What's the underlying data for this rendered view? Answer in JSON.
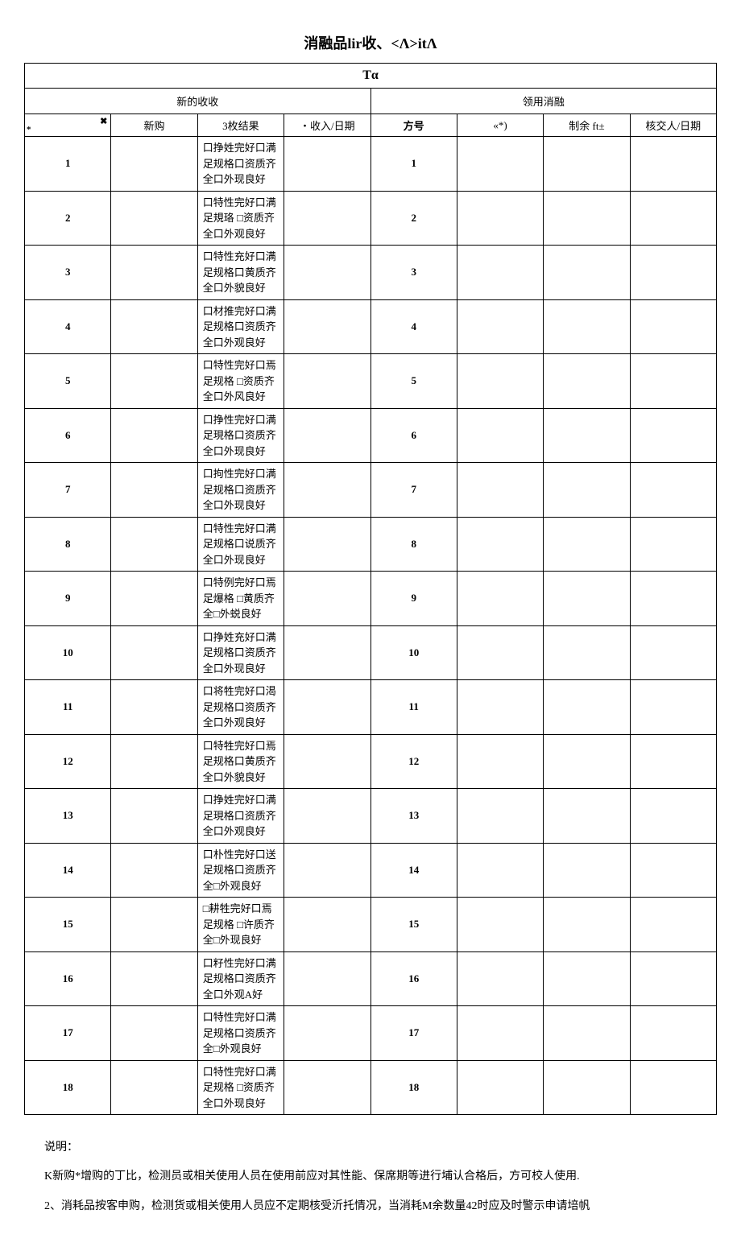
{
  "page_title": "消融品lir收、<Λ>itΛ",
  "table": {
    "top_header": "Tα",
    "left_section": "新的收收",
    "right_section": "领用消融",
    "headers": {
      "idx_symbol_top": "✖",
      "idx_symbol_bottom": "*",
      "xingou": "新购",
      "result": "3枚结果",
      "date_in": "・收入/日期",
      "fanghao": "方号",
      "star_col": "«*)",
      "zhiyu": "制余 ft±",
      "hejiao": "核交人/日期"
    },
    "rows": [
      {
        "idx": "1",
        "result": "口挣姓完好口满足规格口资质齐全口外现良好",
        "fh": "1"
      },
      {
        "idx": "2",
        "result": "口特性完好口满足規珞 □资质齐全口外观良好",
        "fh": "2"
      },
      {
        "idx": "3",
        "result": "口特性充好口满足规格口黄质齐全口外貌良好",
        "fh": "3"
      },
      {
        "idx": "4",
        "result": "口材推完好口满足规格口资质齐全口外观良好",
        "fh": "4"
      },
      {
        "idx": "5",
        "result": "口特性完好口焉足规格 □资质齐全口外风良好",
        "fh": "5"
      },
      {
        "idx": "6",
        "result": "口挣性完好口满足現格口资质齐全口外现良好",
        "fh": "6"
      },
      {
        "idx": "7",
        "result": "口拘性完好口满足规格口资质齐全口外现良好",
        "fh": "7"
      },
      {
        "idx": "8",
        "result": "口特性完好口满足规格口说质齐全口外现良好",
        "fh": "8"
      },
      {
        "idx": "9",
        "result": "口特例完好口焉足爆格 □黄质齐全□外蜕良好",
        "fh": "9"
      },
      {
        "idx": "10",
        "result": "口挣姓充好口满足规格口资质齐全口外现良好",
        "fh": "10"
      },
      {
        "idx": "11",
        "result": "口将牲完好口渴足规格口资质齐全口外观良好",
        "fh": "11"
      },
      {
        "idx": "12",
        "result": "口特牲完好口焉足规格口黄质齐全口外貌良好",
        "fh": "12"
      },
      {
        "idx": "13",
        "result": "口挣姓完好口满足現格口资质齐全口外观良好",
        "fh": "13"
      },
      {
        "idx": "14",
        "result": "口朴性完好口送足规格口资质齐全□外观良好",
        "fh": "14"
      },
      {
        "idx": "15",
        "result": "□耕牲完好口焉足规格 □许质齐全□外现良好",
        "fh": "15"
      },
      {
        "idx": "16",
        "result": "口籽性完好口满足规格口资质齐全口外观A好",
        "fh": "16"
      },
      {
        "idx": "17",
        "result": "口特性完好口满足规格口资质齐全□外观良好",
        "fh": "17"
      },
      {
        "idx": "18",
        "result": "口特性完好口满足规格 □资质齐全口外现良好",
        "fh": "18"
      }
    ]
  },
  "notes": {
    "heading": "说明：",
    "line1": "K新购*增购的丁比，检测员或相关使用人员在使用前应对其性能、保席期等进行埔认合格后，方可校人使用.",
    "line2": "2、消耗品按客申购，检测货或相关使用人员应不定期核受沂托情况，当消耗M余数量42时应及时警示申请培帆"
  }
}
